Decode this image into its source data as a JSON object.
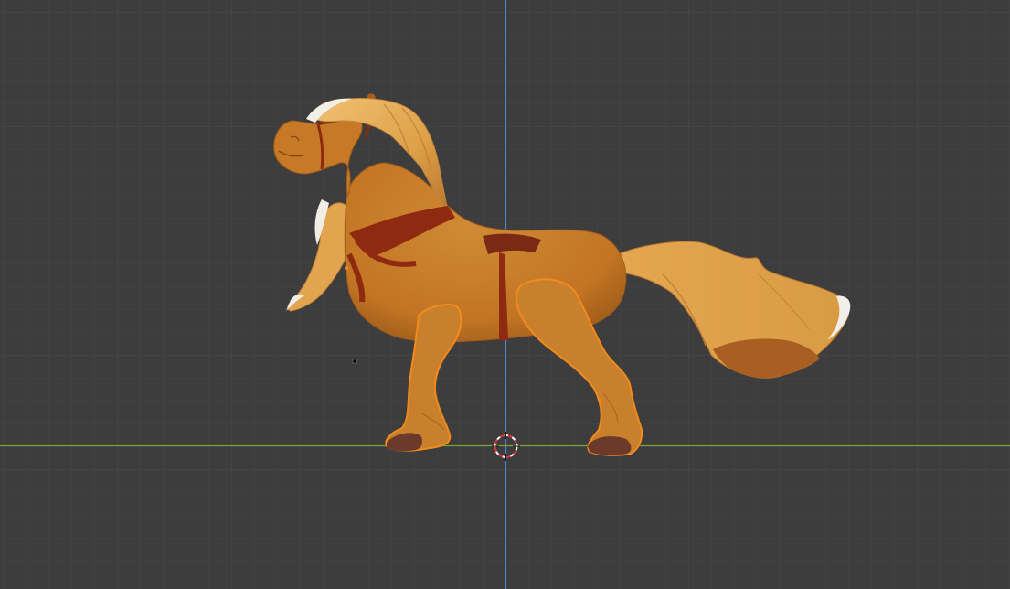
{
  "app": "3D viewport",
  "viewport": {
    "background_color": "#3d3d3d",
    "grid_minor_color": "#444444",
    "grid_major_color": "#4a4a4a",
    "x_axis_color": "#7aa336",
    "z_axis_color": "#4f7fd3",
    "selection_outline_color": "#f28a1d"
  },
  "scene": {
    "object": "horse-model",
    "selected_parts": [
      "front-leg",
      "hind-leg"
    ],
    "body_color": "#c47a28",
    "mane_color": "#e3a24a",
    "strap_color": "#8e2a10",
    "hoof_color": "#6b3a2b"
  },
  "overlays": {
    "cursor_icon": "3d-cursor-icon",
    "origin_icon": "object-origin-icon"
  }
}
